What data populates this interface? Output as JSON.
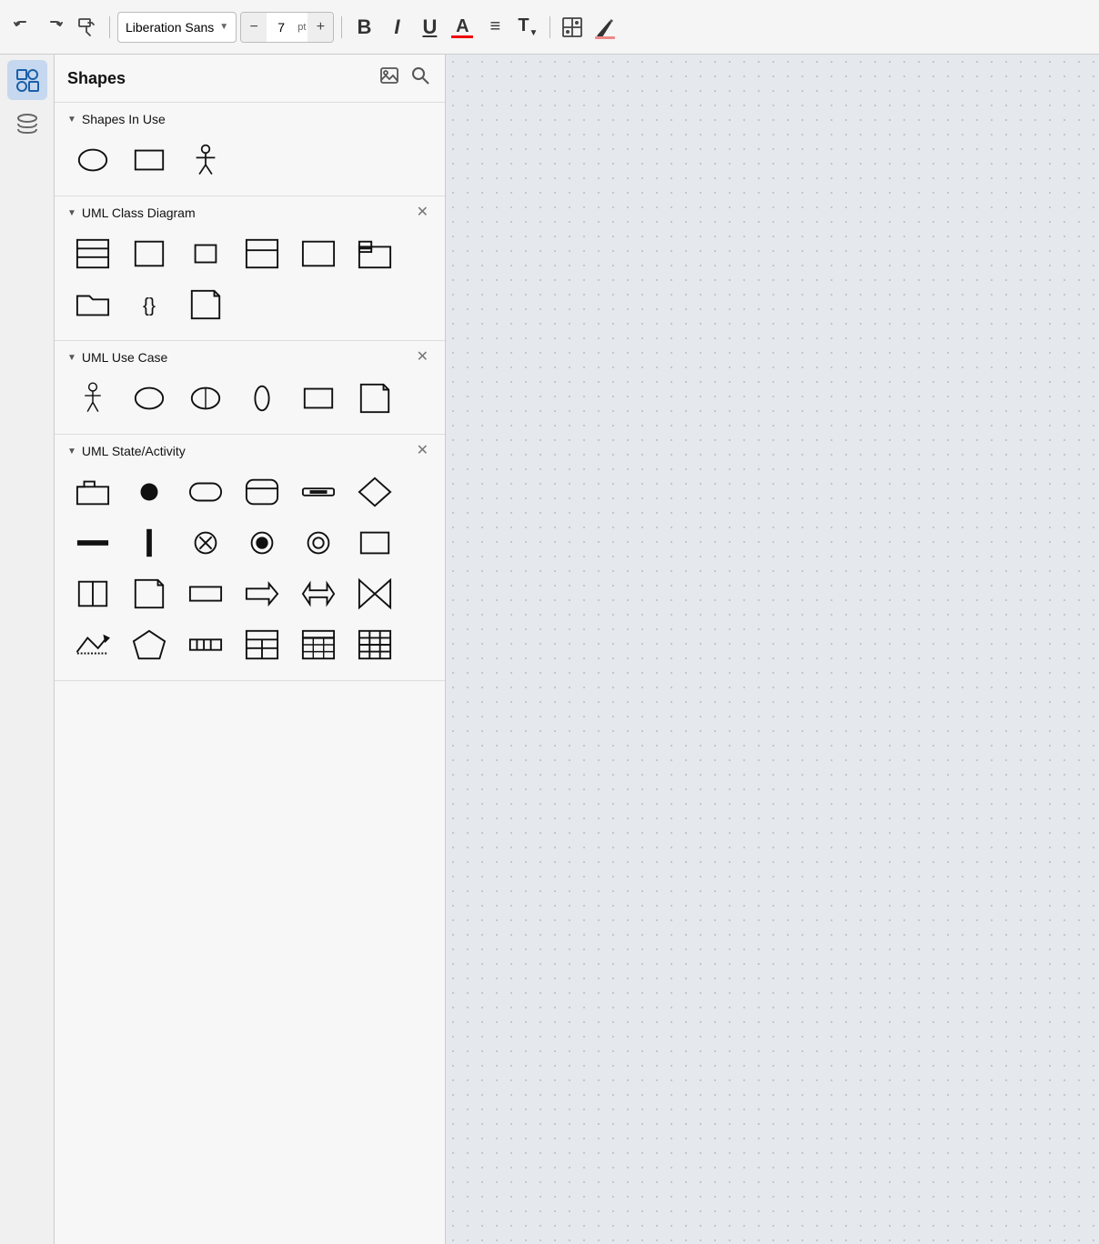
{
  "toolbar": {
    "undo_label": "↩",
    "redo_label": "↪",
    "format_painter_label": "🖌",
    "font_name": "Liberation Sans",
    "font_size": "7",
    "minus_label": "−",
    "plus_label": "+",
    "bold_label": "B",
    "italic_label": "I",
    "underline_label": "U",
    "text_color_label": "A",
    "align_label": "≡",
    "text_style_label": "T",
    "insert_image_label": "⊞",
    "fill_label": "●"
  },
  "icon_sidebar": {
    "shapes_icon_label": "shapes",
    "layers_icon_label": "layers"
  },
  "shapes_panel": {
    "title": "Shapes",
    "image_action": "🖼",
    "search_action": "🔍",
    "sections": [
      {
        "id": "shapes-in-use",
        "title": "Shapes In Use",
        "closeable": false,
        "shapes": [
          {
            "name": "ellipse",
            "symbol": "ellipse"
          },
          {
            "name": "rectangle",
            "symbol": "rectangle"
          },
          {
            "name": "actor",
            "symbol": "actor"
          }
        ]
      },
      {
        "id": "uml-class-diagram",
        "title": "UML Class Diagram",
        "closeable": true,
        "shapes": [
          {
            "name": "class-box-header",
            "symbol": "class-box-header"
          },
          {
            "name": "rectangle",
            "symbol": "rectangle"
          },
          {
            "name": "rectangle-small",
            "symbol": "rectangle-small"
          },
          {
            "name": "class-section",
            "symbol": "class-section"
          },
          {
            "name": "rect-plain",
            "symbol": "rect-plain"
          },
          {
            "name": "package-folder",
            "symbol": "package-folder"
          },
          {
            "name": "folder-open",
            "symbol": "folder-open"
          },
          {
            "name": "interface-brace",
            "symbol": "interface-brace"
          },
          {
            "name": "note",
            "symbol": "note"
          }
        ]
      },
      {
        "id": "uml-use-case",
        "title": "UML Use Case",
        "closeable": true,
        "shapes": [
          {
            "name": "actor",
            "symbol": "actor"
          },
          {
            "name": "ellipse",
            "symbol": "ellipse"
          },
          {
            "name": "ellipse-half",
            "symbol": "ellipse-half"
          },
          {
            "name": "ellipse-narrow",
            "symbol": "ellipse-narrow"
          },
          {
            "name": "rectangle",
            "symbol": "rectangle"
          },
          {
            "name": "note",
            "symbol": "note"
          }
        ]
      },
      {
        "id": "uml-state-activity",
        "title": "UML State/Activity",
        "closeable": true,
        "shapes": [
          {
            "name": "folder-tab",
            "symbol": "folder-tab"
          },
          {
            "name": "filled-circle",
            "symbol": "filled-circle"
          },
          {
            "name": "rounded-rect",
            "symbol": "rounded-rect"
          },
          {
            "name": "action-box",
            "symbol": "action-box"
          },
          {
            "name": "fork-join-h",
            "symbol": "fork-join-h"
          },
          {
            "name": "diamond",
            "symbol": "diamond"
          },
          {
            "name": "h-line",
            "symbol": "h-line"
          },
          {
            "name": "v-line",
            "symbol": "v-line"
          },
          {
            "name": "end-circle-x",
            "symbol": "end-circle-x"
          },
          {
            "name": "end-circle-h",
            "symbol": "end-circle-h"
          },
          {
            "name": "circle-inner",
            "symbol": "circle-inner"
          },
          {
            "name": "rectangle2",
            "symbol": "rectangle2"
          },
          {
            "name": "v-line-box",
            "symbol": "v-line-box"
          },
          {
            "name": "note2",
            "symbol": "note2"
          },
          {
            "name": "rect-small",
            "symbol": "rect-small"
          },
          {
            "name": "arrow-right",
            "symbol": "arrow-right"
          },
          {
            "name": "arrow-double",
            "symbol": "arrow-double"
          },
          {
            "name": "hourglass",
            "symbol": "hourglass"
          },
          {
            "name": "arrow-zigzag",
            "symbol": "arrow-zigzag"
          },
          {
            "name": "pentagon",
            "symbol": "pentagon"
          },
          {
            "name": "bar-horizontal",
            "symbol": "bar-horizontal"
          },
          {
            "name": "grid-simple",
            "symbol": "grid-simple"
          },
          {
            "name": "grid-header",
            "symbol": "grid-header"
          },
          {
            "name": "grid-full",
            "symbol": "grid-full"
          }
        ]
      }
    ]
  }
}
